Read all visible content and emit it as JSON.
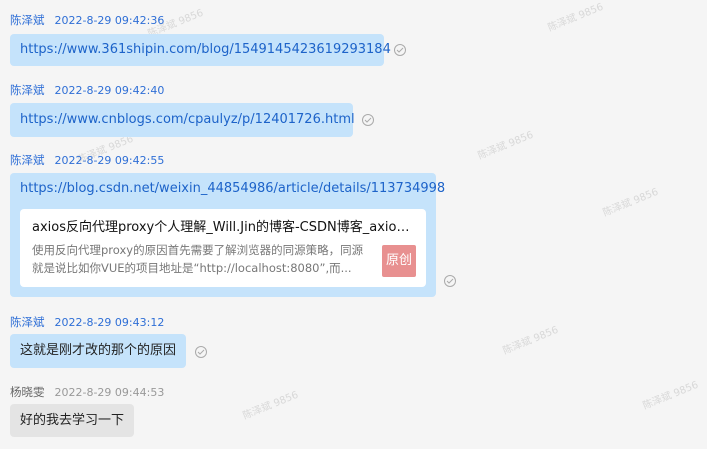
{
  "watermark": "陈泽斌 9856",
  "messages": [
    {
      "sender": "陈泽斌",
      "time": "2022-8-29 09:42:36",
      "text": "https://www.361shipin.com/blog/1549145423619293184"
    },
    {
      "sender": "陈泽斌",
      "time": "2022-8-29 09:42:40",
      "text": "https://www.cnblogs.com/cpaulyz/p/12401726.html"
    },
    {
      "sender": "陈泽斌",
      "time": "2022-8-29 09:42:55",
      "text": "https://blog.csdn.net/weixin_44854986/article/details/113734998",
      "card": {
        "title": "axios反向代理proxy个人理解_Will.Jin的博客-CSDN博客_axios...",
        "desc_line1": "使用反向代理proxy的原因首先需要了解浏览器的同源策略，同源",
        "desc_line2": "就是说比如你VUE的项目地址是“http://localhost:8080”,而...",
        "badge": "原创"
      }
    },
    {
      "sender": "陈泽斌",
      "time": "2022-8-29 09:43:12",
      "text": "这就是刚才改的那个的原因"
    },
    {
      "sender": "杨晓雯",
      "time": "2022-8-29 09:44:53",
      "text": "好的我去学习一下"
    }
  ],
  "icons": {
    "read_status": "check-circle-icon"
  },
  "colors": {
    "my_bubble": "#c5e3fb",
    "other_bubble": "#e4e4e4",
    "link": "#1d63c9",
    "sender": "#2f6fd6"
  }
}
